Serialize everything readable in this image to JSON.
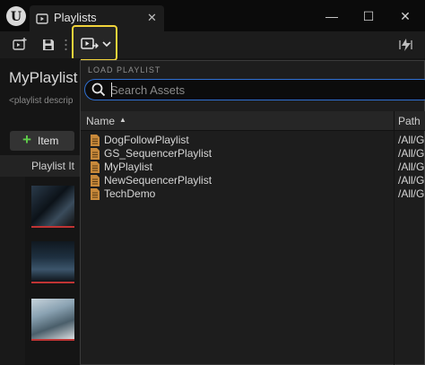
{
  "window": {
    "tab_title": "Playlists",
    "tab_close": "✕",
    "minimize": "—",
    "maximize": "☐",
    "close": "✕"
  },
  "toolbar": {
    "icons": [
      "new-playlist-icon",
      "save-icon",
      "load-playlist-icon",
      "chevron-down-icon",
      "sequencer-icon"
    ]
  },
  "playlist": {
    "title": "MyPlaylist",
    "description_placeholder": "<playlist descrip",
    "add_item_label": "Item",
    "add_item_symbol": "+",
    "column_header": "Playlist It"
  },
  "dropdown": {
    "heading": "LOAD PLAYLIST",
    "search_placeholder": "Search Assets",
    "columns": {
      "name": "Name",
      "path": "Path"
    },
    "sort_indicator": "▲",
    "items": [
      {
        "name": "DogFollowPlaylist",
        "path": "/All/G"
      },
      {
        "name": "GS_SequencerPlaylist",
        "path": "/All/G"
      },
      {
        "name": "MyPlaylist",
        "path": "/All/G"
      },
      {
        "name": "NewSequencerPlaylist",
        "path": "/All/G"
      },
      {
        "name": "TechDemo",
        "path": "/All/G"
      }
    ]
  },
  "colors": {
    "accent_highlight": "#f2d43b",
    "search_border": "#2f6fd1",
    "add_green": "#5fcf4a",
    "asset_icon": "#c8893a"
  }
}
